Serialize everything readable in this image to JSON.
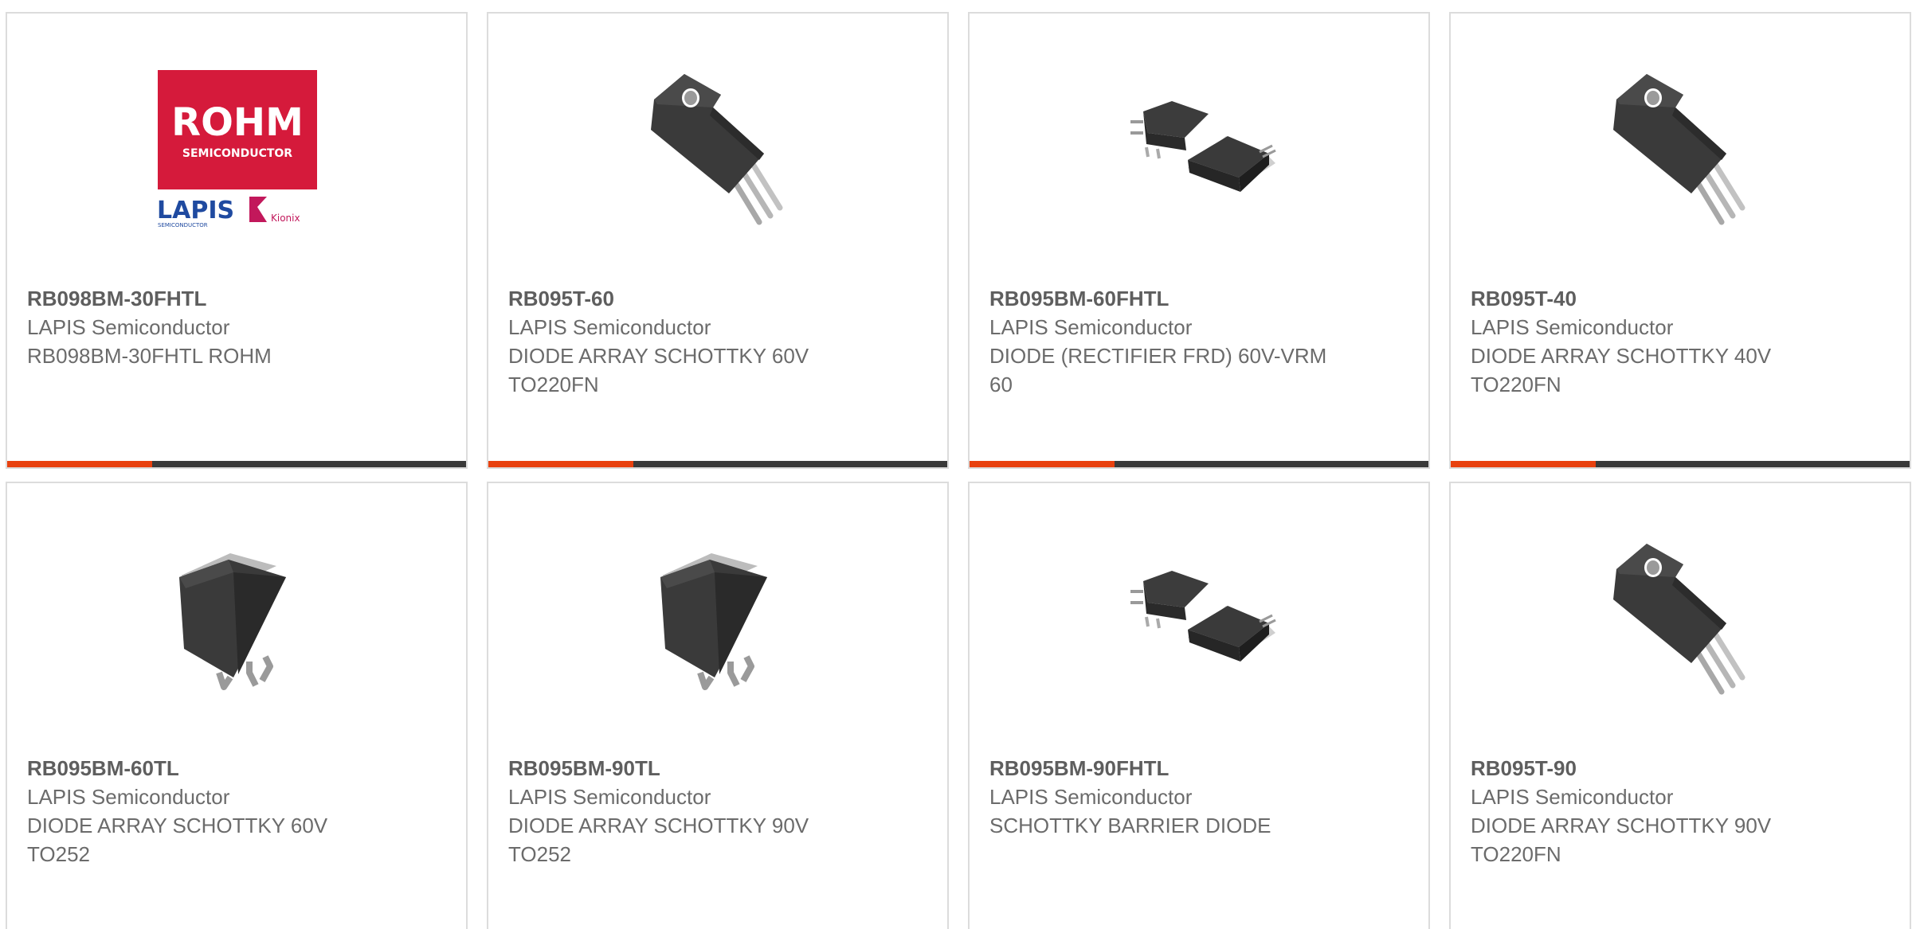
{
  "colors": {
    "accent": "#e8410f",
    "bar_dark": "#3a3a3a",
    "card_border": "#dcdcdc",
    "text": "#6b6b6b",
    "rohm_red": "#d51a3b",
    "lapis_blue": "#1f4aa0",
    "kionix_pink": "#c2185b"
  },
  "logo": {
    "brand": "ROHM",
    "tagline": "SEMICONDUCTOR",
    "lapis": "LAPIS",
    "lapis_sub": "SEMICONDUCTOR",
    "kionix": "Kionix"
  },
  "products": [
    {
      "part": "RB098BM-30FHTL",
      "manufacturer": "LAPIS Semiconductor",
      "desc": "RB098BM-30FHTL ROHM",
      "image": "rohm-logo"
    },
    {
      "part": "RB095T-60",
      "manufacturer": "LAPIS Semiconductor",
      "desc": "DIODE ARRAY SCHOTTKY 60V TO220FN",
      "image": "to220-package"
    },
    {
      "part": "RB095BM-60FHTL",
      "manufacturer": "LAPIS Semiconductor",
      "desc": "DIODE (RECTIFIER FRD) 60V-VRM 60",
      "image": "dpak-pair-package"
    },
    {
      "part": "RB095T-40",
      "manufacturer": "LAPIS Semiconductor",
      "desc": "DIODE ARRAY SCHOTTKY 40V TO220FN",
      "image": "to220-package"
    },
    {
      "part": "RB095BM-60TL",
      "manufacturer": "LAPIS Semiconductor",
      "desc": "DIODE ARRAY SCHOTTKY 60V TO252",
      "image": "to252-package"
    },
    {
      "part": "RB095BM-90TL",
      "manufacturer": "LAPIS Semiconductor",
      "desc": "DIODE ARRAY SCHOTTKY 90V TO252",
      "image": "to252-package"
    },
    {
      "part": "RB095BM-90FHTL",
      "manufacturer": "LAPIS Semiconductor",
      "desc": "SCHOTTKY BARRIER DIODE",
      "image": "dpak-pair-package"
    },
    {
      "part": "RB095T-90",
      "manufacturer": "LAPIS Semiconductor",
      "desc": "DIODE ARRAY SCHOTTKY 90V TO220FN",
      "image": "to220-package"
    }
  ]
}
